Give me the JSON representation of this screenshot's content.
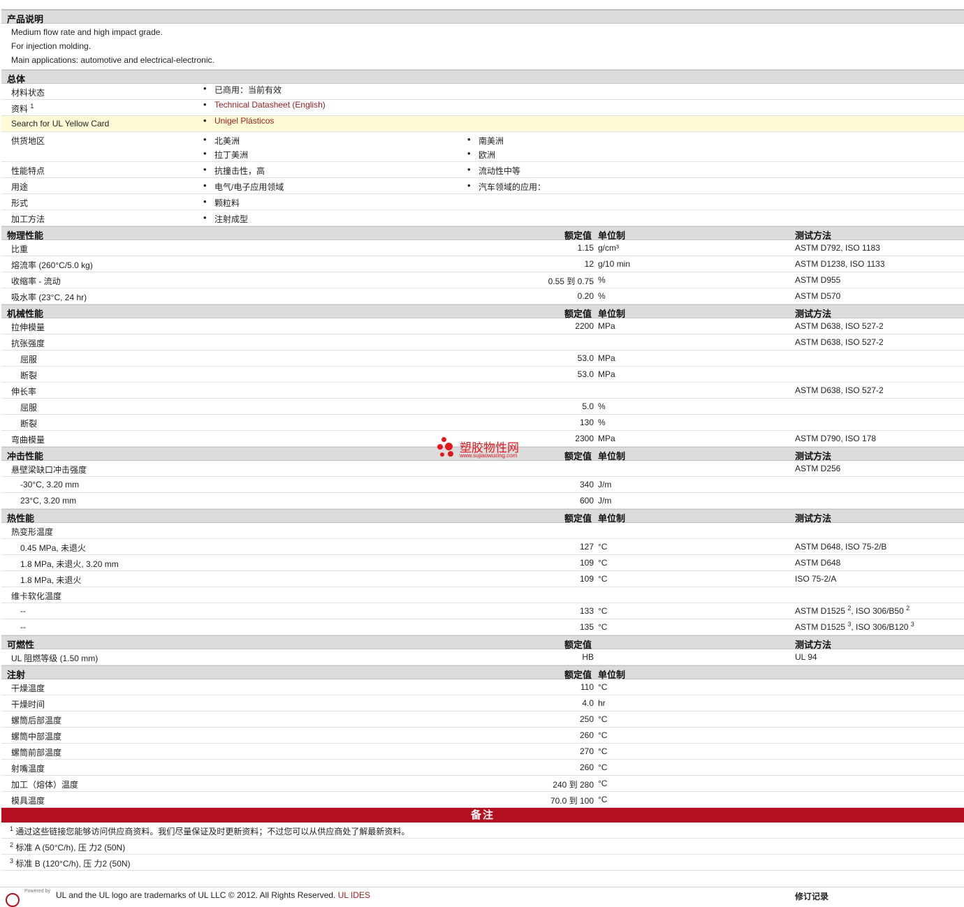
{
  "sections": {
    "desc_title": "产品说明",
    "general_title": "总体",
    "phys_title": "物理性能",
    "mech_title": "机械性能",
    "impact_title": "冲击性能",
    "thermal_title": "热性能",
    "flam_title": "可燃性",
    "inj_title": "注射"
  },
  "headers": {
    "nominal": "额定值",
    "unit": "单位制",
    "method": "测试方法"
  },
  "description": [
    "Medium flow rate and high impact grade.",
    "For injection molding.",
    "Main applications: automotive and electrical-electronic."
  ],
  "general": {
    "status_label": "材料状态",
    "status_value": "已商用：当前有效",
    "data_label": "资料",
    "data_sup": "1",
    "data_link": "Technical Datasheet (English)",
    "ul_label": "Search for UL Yellow Card",
    "ul_link": "Unigel Plásticos",
    "region_label": "供货地区",
    "regions": [
      "北美洲",
      "南美洲",
      "拉丁美洲",
      "欧洲"
    ],
    "features_label": "性能特点",
    "features": [
      "抗撞击性，高",
      "流动性中等"
    ],
    "uses_label": "用途",
    "uses": [
      "电气/电子应用领域",
      "汽车领域的应用："
    ],
    "form_label": "形式",
    "form": "颗粒料",
    "process_label": "加工方法",
    "process": "注射成型"
  },
  "physical": [
    {
      "label": "比重",
      "value": "1.15",
      "unit": "g/cm³",
      "method": "ASTM D792, ISO 1183"
    },
    {
      "label": "熔流率  (260°C/5.0 kg)",
      "value": "12",
      "unit": "g/10 min",
      "method": "ASTM D1238, ISO 1133"
    },
    {
      "label": "收缩率  - 流动",
      "value": "0.55 到  0.75",
      "unit": "%",
      "method": "ASTM D955"
    },
    {
      "label": "吸水率  (23°C, 24 hr)",
      "value": "0.20",
      "unit": "%",
      "method": "ASTM D570"
    }
  ],
  "mechanical": [
    {
      "label": "拉伸模量",
      "value": "2200",
      "unit": "MPa",
      "method": "ASTM D638, ISO 527-2"
    },
    {
      "label": "抗张强度",
      "value": "",
      "unit": "",
      "method": "ASTM D638, ISO 527-2"
    },
    {
      "label": "屈服",
      "value": "53.0",
      "unit": "MPa",
      "method": ""
    },
    {
      "label": "断裂",
      "value": "53.0",
      "unit": "MPa",
      "method": ""
    },
    {
      "label": "伸长率",
      "value": "",
      "unit": "",
      "method": "ASTM D638, ISO 527-2"
    },
    {
      "label": "屈服",
      "value": "5.0",
      "unit": "%",
      "method": ""
    },
    {
      "label": "断裂",
      "value": "130",
      "unit": "%",
      "method": ""
    },
    {
      "label": "弯曲模量",
      "value": "2300",
      "unit": "MPa",
      "method": "ASTM D790, ISO 178"
    }
  ],
  "impact": [
    {
      "label": "悬壁梁缺口冲击强度",
      "value": "",
      "unit": "",
      "method": "ASTM D256"
    },
    {
      "label": "-30°C, 3.20 mm",
      "value": "340",
      "unit": "J/m",
      "method": ""
    },
    {
      "label": "23°C, 3.20 mm",
      "value": "600",
      "unit": "J/m",
      "method": ""
    }
  ],
  "thermal": {
    "hdt_label": "热变形温度",
    "hdt_rows": [
      {
        "label": "0.45 MPa, 未退火",
        "value": "127",
        "unit": "°C",
        "method": "ASTM D648, ISO 75-2/B"
      },
      {
        "label": "1.8 MPa, 未退火, 3.20 mm",
        "value": "109",
        "unit": "°C",
        "method": "ASTM D648"
      },
      {
        "label": "1.8 MPa, 未退火",
        "value": "109",
        "unit": "°C",
        "method": "ISO 75-2/A"
      }
    ],
    "vicat_label": "维卡软化温度",
    "vicat_rows": [
      {
        "label": "--",
        "value": "133",
        "unit": "°C",
        "m1": "ASTM D1525",
        "s1": "2",
        "m2": ", ISO 306/B50",
        "s2": "2"
      },
      {
        "label": "--",
        "value": "135",
        "unit": "°C",
        "m1": "ASTM D1525",
        "s1": "3",
        "m2": ", ISO 306/B120",
        "s2": "3"
      }
    ]
  },
  "flammability": {
    "label": "UL 阻燃等级  (1.50 mm)",
    "value": "HB",
    "method": "UL 94"
  },
  "injection": [
    {
      "label": "干燥温度",
      "value": "110",
      "unit": "°C"
    },
    {
      "label": "干燥时间",
      "value": "4.0",
      "unit": "hr"
    },
    {
      "label": "螺筒后部温度",
      "value": "250",
      "unit": "°C"
    },
    {
      "label": "螺筒中部温度",
      "value": "260",
      "unit": "°C"
    },
    {
      "label": "螺筒前部温度",
      "value": "270",
      "unit": "°C"
    },
    {
      "label": "射嘴温度",
      "value": "260",
      "unit": "°C"
    },
    {
      "label": "加工（熔体）温度",
      "value": "240 到  280",
      "unit": "°C"
    },
    {
      "label": "模具温度",
      "value": "70.0 到  100",
      "unit": "°C"
    }
  ],
  "notes": {
    "title": "备注",
    "items": [
      {
        "num": "1",
        "text": "通过这些链接您能够访问供应商资料。我们尽量保证及时更新资料；不过您可以从供应商处了解最新资料。"
      },
      {
        "num": "2",
        "text": "标准  A (50°C/h), 压  力2 (50N)"
      },
      {
        "num": "3",
        "text": "标准  B (120°C/h), 压  力2 (50N)"
      }
    ]
  },
  "footer": {
    "powered": "Powered by",
    "trademark": "UL and the UL logo are trademarks of UL LLC © 2012. All Rights Reserved.",
    "trademark_link": "UL IDES",
    "revision": "修订记录"
  },
  "watermark": {
    "text": "塑胶物性网",
    "url": "www.sujiaowuxing.com"
  },
  "colors": {
    "accent": "#b5101f",
    "link": "#9c1a1a",
    "section_bg": "#dcdcdc",
    "highlight": "#fffad6"
  }
}
